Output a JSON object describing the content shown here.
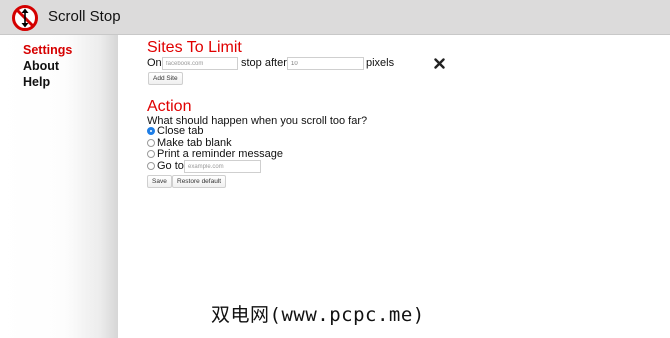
{
  "header": {
    "title": "Scroll Stop",
    "logo_icon": "no-scroll-icon"
  },
  "sidebar": {
    "items": [
      {
        "label": "Settings",
        "active": true
      },
      {
        "label": "About",
        "active": false
      },
      {
        "label": "Help",
        "active": false
      }
    ]
  },
  "sites": {
    "title": "Sites To Limit",
    "on_label": "On",
    "site_placeholder": "facebook.com",
    "stop_after_label": "stop after",
    "pixels_value": "10",
    "pixels_label": "pixels",
    "remove_icon": "close-icon",
    "add_button": "Add Site"
  },
  "action": {
    "title": "Action",
    "question": "What should happen when you scroll too far?",
    "options": [
      {
        "label": "Close tab",
        "checked": true
      },
      {
        "label": "Make tab blank",
        "checked": false
      },
      {
        "label": "Print a reminder message",
        "checked": false
      },
      {
        "label": "Go to",
        "checked": false
      }
    ],
    "goto_placeholder": "example.com",
    "save_button": "Save",
    "restore_button": "Restore default"
  },
  "watermark": "双电网(www.pcpc.me)",
  "colors": {
    "accent_red": "#e00000",
    "radio_blue": "#1f7ee6",
    "header_bg": "#dcdbdb"
  }
}
